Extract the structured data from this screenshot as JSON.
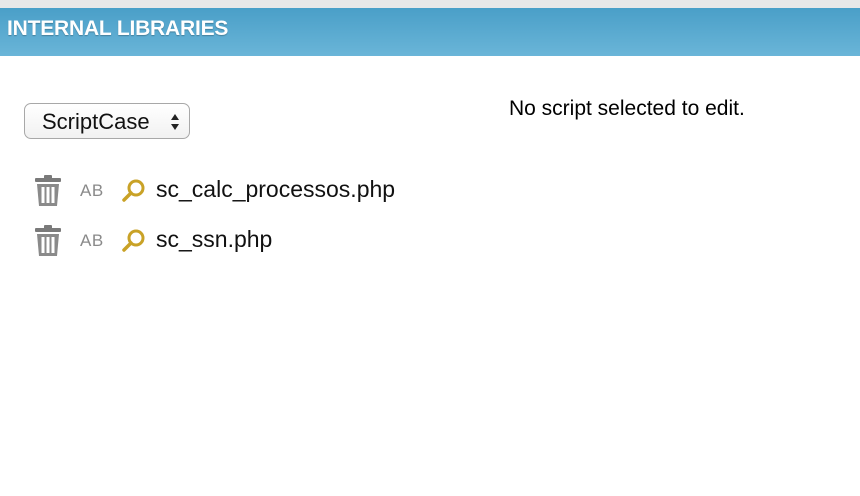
{
  "header": {
    "title": "INTERNAL LIBRARIES",
    "bg_color": "#5aaad2"
  },
  "library_select": {
    "selected": "ScriptCase"
  },
  "editor": {
    "empty_message": "No script selected to edit."
  },
  "files": [
    {
      "name": "sc_calc_processos.php",
      "rename_label": "AB",
      "delete_icon": "trash-icon",
      "open_icon": "search-icon"
    },
    {
      "name": "sc_ssn.php",
      "rename_label": "AB",
      "delete_icon": "trash-icon",
      "open_icon": "search-icon"
    }
  ],
  "colors": {
    "icon_gold": "#c9a227",
    "icon_gray": "#777777"
  }
}
